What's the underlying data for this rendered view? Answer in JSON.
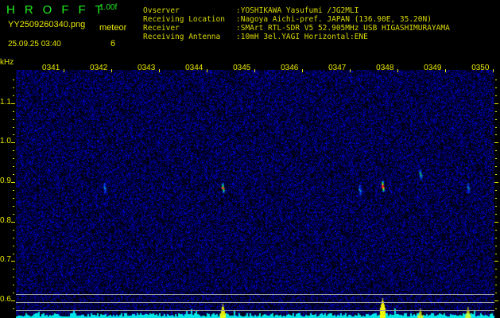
{
  "header": {
    "app_title": "HROFFT",
    "version": "1.00f",
    "filename": "YY2509260340.png",
    "datetime": "25.09.25 03:40",
    "meteor_label": "meteor",
    "meteor_count": "6"
  },
  "info": [
    {
      "label": "Ovserver",
      "value": ":YOSHIKAWA Yasufumi /JG2MLI"
    },
    {
      "label": "Receiving Location",
      "value": ":Nagoya Aichi-pref. JAPAN (136.90E, 35.20N)"
    },
    {
      "label": "Receiver",
      "value": ":SMArt RTL-SDR V5 52.905MHz USB HIGASHIMURAYAMA"
    },
    {
      "label": "Receiving Antenna",
      "value": ":10mH 3el.YAGI Horizontal:ENE"
    }
  ],
  "colors": {
    "background": "#000000",
    "noise": "#1010a0",
    "label": "#e8e800",
    "title": "#22ee22",
    "histogram": "#00e8e8",
    "histogram_peak": "#ffff00"
  },
  "chart_data": {
    "type": "heatmap",
    "title": "HROFFT spectrogram",
    "ylabel": "kHz",
    "yticks": [
      "1.1",
      "1.0",
      "0.9",
      "0.8",
      "0.7",
      "0.6"
    ],
    "ylim": [
      0.556,
      1.184
    ],
    "xticks": [
      "0341",
      "0342",
      "0343",
      "0344",
      "0345",
      "0346",
      "0347",
      "0348",
      "0349",
      "0350"
    ],
    "xlim_minutes": [
      0,
      10.03
    ],
    "meteors": [
      {
        "minute": 1.85,
        "khz": 0.886,
        "strength": 1
      },
      {
        "minute": 4.33,
        "khz": 0.886,
        "strength": 3
      },
      {
        "minute": 7.2,
        "khz": 0.88,
        "strength": 1
      },
      {
        "minute": 7.68,
        "khz": 0.89,
        "strength": 4
      },
      {
        "minute": 8.47,
        "khz": 0.92,
        "strength": 2
      },
      {
        "minute": 9.47,
        "khz": 0.886,
        "strength": 1
      }
    ],
    "histogram_peaks": [
      {
        "minute": 4.33,
        "level": 18
      },
      {
        "minute": 7.68,
        "level": 25
      },
      {
        "minute": 8.47,
        "level": 12
      },
      {
        "minute": 9.47,
        "level": 14
      }
    ]
  }
}
